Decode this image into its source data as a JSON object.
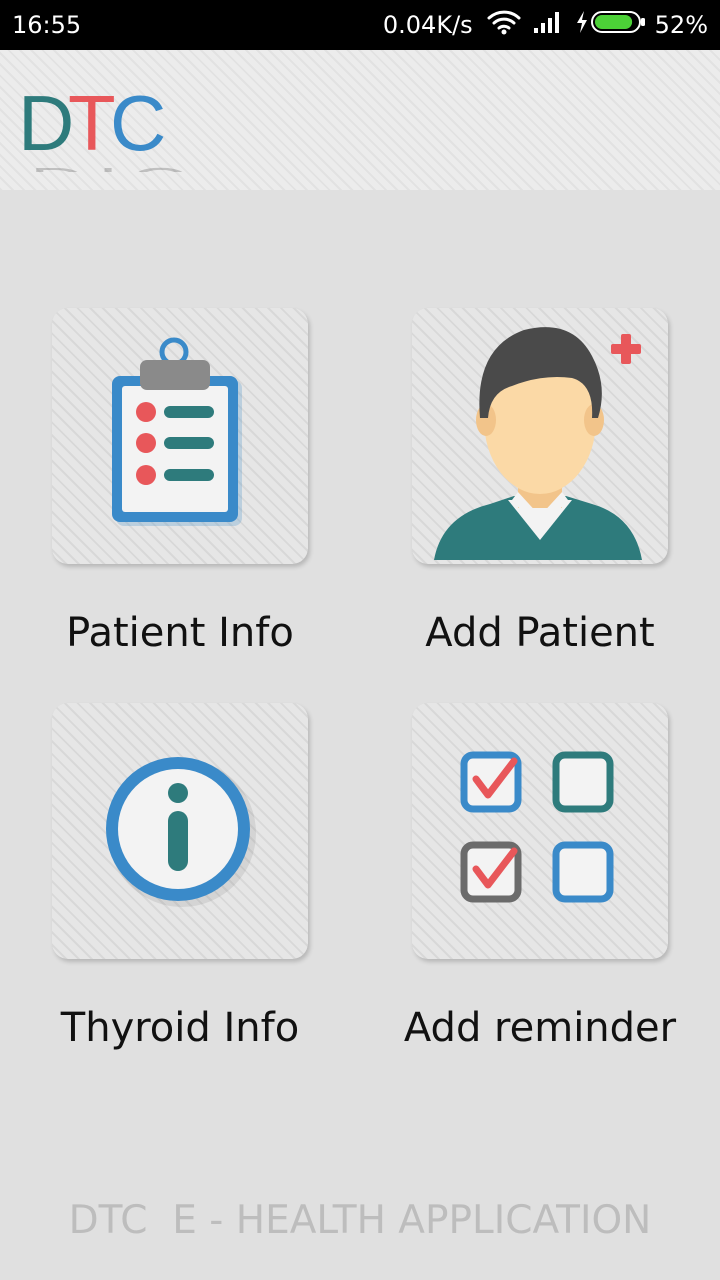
{
  "status_bar": {
    "time": "16:55",
    "net_speed": "0.04K/s",
    "battery_level": 0.52,
    "battery_percent": "52%",
    "icons": [
      "wifi-icon",
      "signal-icon",
      "charging-icon",
      "battery-icon"
    ]
  },
  "header": {
    "logo": {
      "letters": [
        "D",
        "T",
        "C"
      ],
      "colors": [
        "#2e7b7c",
        "#e8575a",
        "#3a8ac9"
      ]
    }
  },
  "menu": {
    "items": [
      {
        "label": "Patient Info",
        "icon": "clipboard-list-icon"
      },
      {
        "label": "Add Patient",
        "icon": "add-user-avatar-icon"
      },
      {
        "label": "Thyroid Info",
        "icon": "info-circle-icon"
      },
      {
        "label": "Add reminder",
        "icon": "checkbox-grid-icon"
      }
    ]
  },
  "footer": {
    "text": "DTC  E - HEALTH APPLICATION"
  },
  "colors": {
    "teal": "#2e7b7c",
    "red": "#e8575a",
    "blue": "#3a8ac9",
    "gray": "#6b6b6b",
    "skin": "#fbd9a6",
    "hair": "#4a4a4a"
  }
}
